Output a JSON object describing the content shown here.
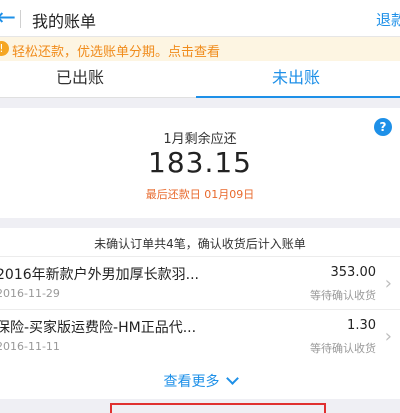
{
  "header": {
    "back_icon": "back-arrow-icon",
    "title": "我的账单",
    "refund_label": "退款"
  },
  "banner": {
    "icon": "alert-icon",
    "text": "轻松还款，优选账单分期。点击查看"
  },
  "tabs": [
    {
      "label": "已出账"
    },
    {
      "label": "未出账"
    }
  ],
  "summary": {
    "remaining_label": "1月剩余应还",
    "amount": "183.15",
    "due_text": "最后还款日 01月09日",
    "help_icon": "?"
  },
  "notice": {
    "text": "未确认订单共4笔，确认收货后计入账单"
  },
  "orders": [
    {
      "name": "2016年新款户外男加厚长款羽...",
      "date": "2016-11-29",
      "amount": "353.00",
      "status": "等待确认收货"
    },
    {
      "name": "保险-买家版运费险-HM正品代...",
      "date": "2016-11-11",
      "amount": "1.30",
      "status": "等待确认收货"
    }
  ],
  "more": {
    "label": "查看更多"
  },
  "colors": {
    "accent": "#1e90e8",
    "warning": "#f08c1c",
    "due": "#e8692c",
    "highlight_box": "#e03030"
  }
}
